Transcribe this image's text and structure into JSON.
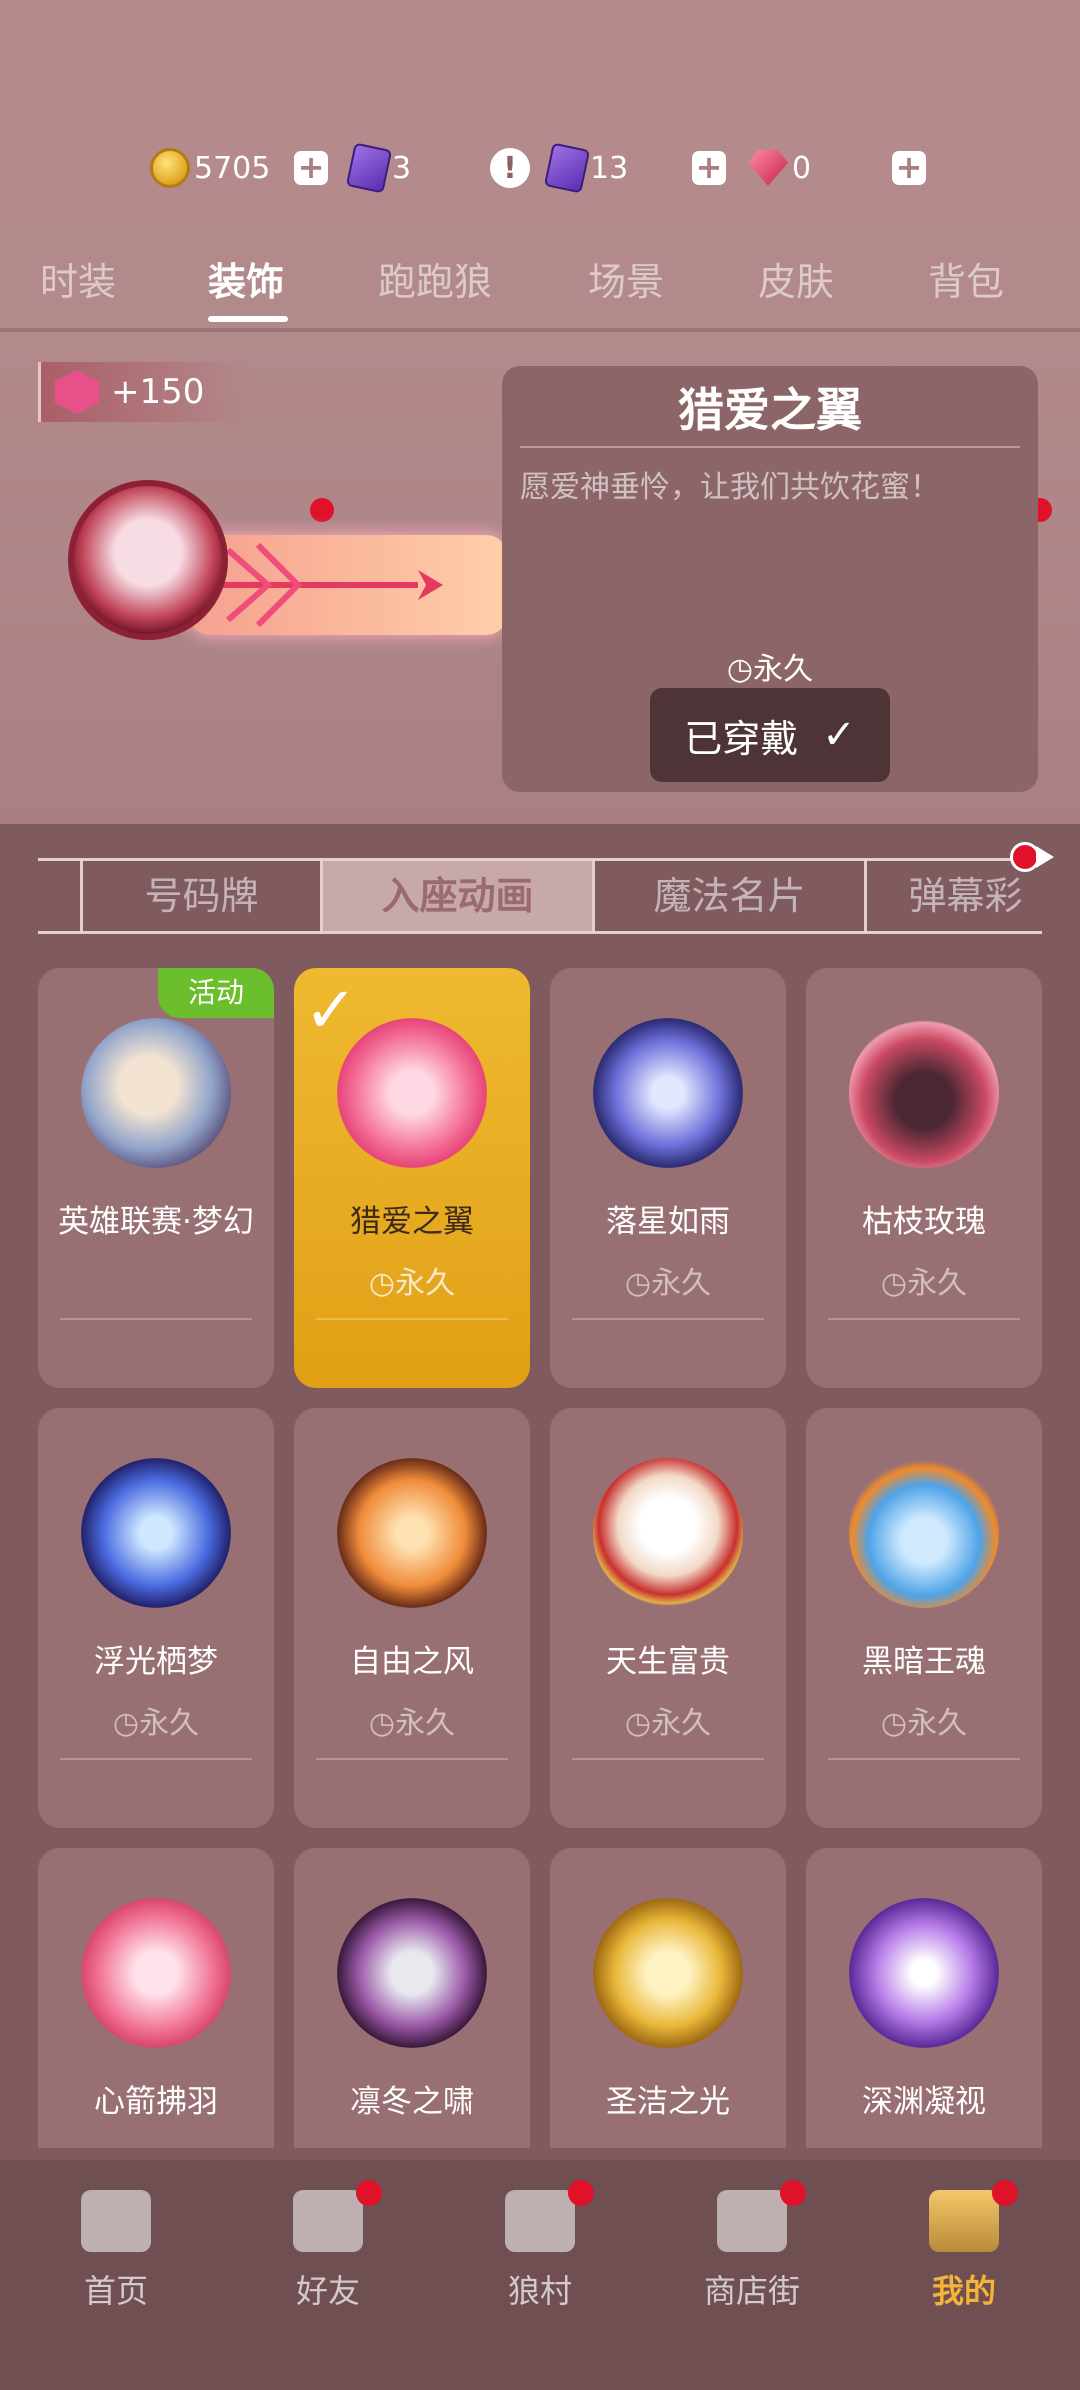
{
  "currency": {
    "coins": "5705",
    "tickets": "3",
    "alert": "!",
    "cards": "13",
    "gems": "0"
  },
  "tabs": [
    {
      "label": "时装",
      "active": false
    },
    {
      "label": "装饰",
      "active": true
    },
    {
      "label": "跑跑狼",
      "active": false
    },
    {
      "label": "场景",
      "active": false
    },
    {
      "label": "皮肤",
      "active": false
    },
    {
      "label": "背包",
      "active": false
    }
  ],
  "preview": {
    "charm_value": "+150",
    "title": "猎爱之翼",
    "description": "愿爱神垂怜，让我们共饮花蜜！",
    "duration": "永久",
    "worn_label": "已穿戴",
    "check": "✓"
  },
  "subtabs": [
    {
      "label": "号码牌"
    },
    {
      "label": "入座动画"
    },
    {
      "label": "魔法名片"
    },
    {
      "label": "弹幕彩"
    }
  ],
  "items": [
    {
      "name": "英雄联赛·梦幻",
      "duration": "",
      "tag": "活动",
      "selected": false
    },
    {
      "name": "猎爱之翼",
      "duration": "永久",
      "selected": true
    },
    {
      "name": "落星如雨",
      "duration": "永久",
      "selected": false
    },
    {
      "name": "枯枝玫瑰",
      "duration": "永久",
      "selected": false
    },
    {
      "name": "浮光栖梦",
      "duration": "永久",
      "selected": false
    },
    {
      "name": "自由之风",
      "duration": "永久",
      "selected": false
    },
    {
      "name": "天生富贵",
      "duration": "永久",
      "selected": false
    },
    {
      "name": "黑暗王魂",
      "duration": "永久",
      "selected": false
    },
    {
      "name": "心箭拂羽",
      "duration": "",
      "selected": false
    },
    {
      "name": "凛冬之啸",
      "duration": "",
      "selected": false
    },
    {
      "name": "圣洁之光",
      "duration": "",
      "selected": false
    },
    {
      "name": "深渊凝视",
      "duration": "",
      "selected": false
    }
  ],
  "nav": [
    {
      "label": "首页",
      "dot": false,
      "active": false
    },
    {
      "label": "好友",
      "dot": true,
      "active": false
    },
    {
      "label": "狼村",
      "dot": true,
      "active": false
    },
    {
      "label": "商店街",
      "dot": true,
      "active": false
    },
    {
      "label": "我的",
      "dot": true,
      "active": true
    }
  ],
  "colors": {
    "accent_gold": "#efb930",
    "badge_red": "#e0122a",
    "event_green": "#6bbf2c",
    "nav_active": "#f3b437"
  }
}
